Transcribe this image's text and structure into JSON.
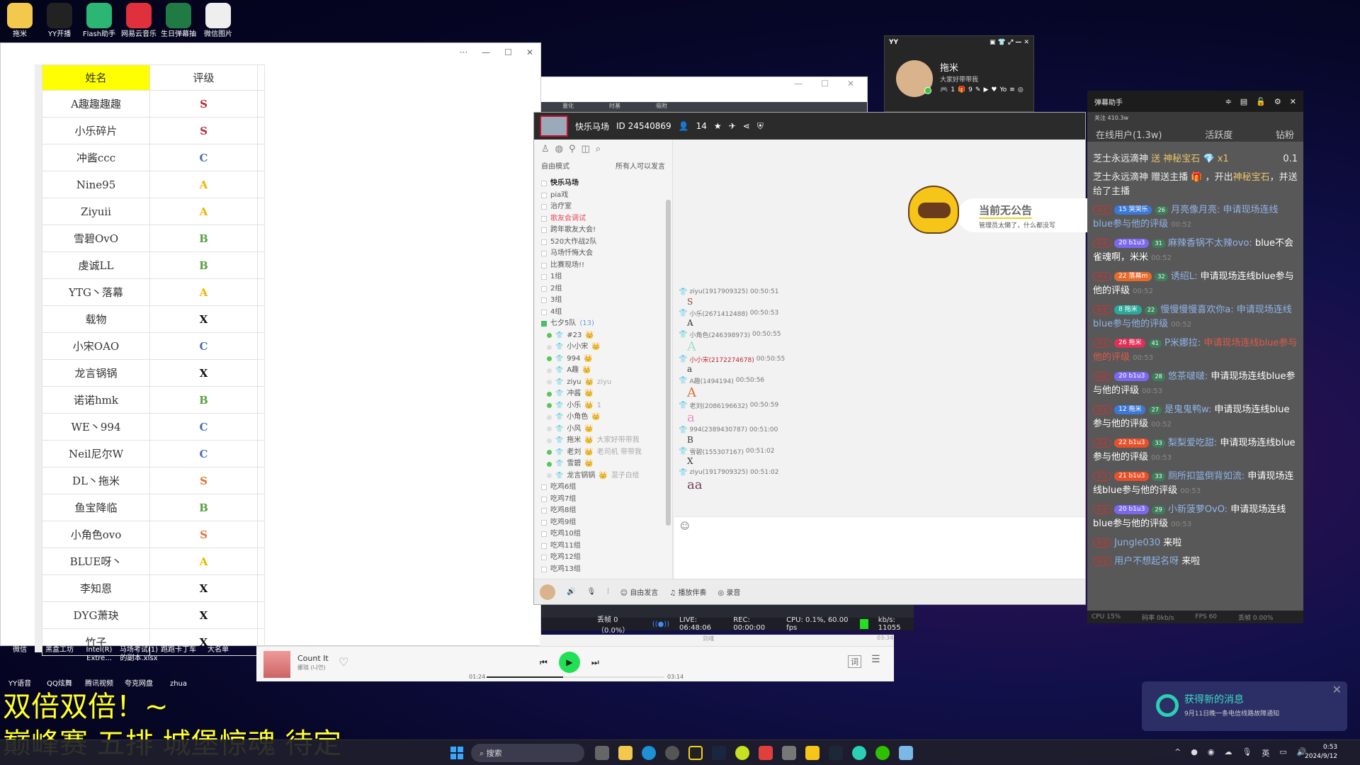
{
  "desktop_icons_top": [
    {
      "label": "拖米",
      "icon": "folder-icon",
      "color": "#f2c94c"
    },
    {
      "label": "YY开播",
      "icon": "yy-live-icon",
      "color": "#222"
    },
    {
      "label": "Flash助手",
      "icon": "flash-icon",
      "color": "#2bb673"
    },
    {
      "label": "网易云音乐",
      "icon": "netease-music-icon",
      "color": "#e0303c"
    },
    {
      "label": "生日弹幕抽",
      "icon": "excel-icon",
      "color": "#1f7a44"
    },
    {
      "label": "微信图片",
      "icon": "image-file-icon",
      "color": "#eee"
    }
  ],
  "desktop_icons_bottom_row1": [
    {
      "label": "微信"
    },
    {
      "label": "黑盒工坊"
    },
    {
      "label": "Intel(R) Extre..."
    },
    {
      "label": "马场考试(1)的副本.xlsx"
    },
    {
      "label": "跑跑卡丁车"
    },
    {
      "label": "大名单"
    }
  ],
  "desktop_icons_bottom_row2": [
    {
      "label": "YY语音"
    },
    {
      "label": "QQ炫舞"
    },
    {
      "label": "腾讯视频"
    },
    {
      "label": "夸克网盘"
    },
    {
      "label": "zhua"
    }
  ],
  "spreadsheet": {
    "window_controls": {
      "more": "···",
      "minimize": "—",
      "maximize": "☐",
      "close": "✕"
    },
    "headers": {
      "name": "姓名",
      "grade": "评级"
    },
    "rows": [
      {
        "name": "A趣趣趣趣",
        "grade": "S",
        "color": "#c0282e"
      },
      {
        "name": "小乐碎片",
        "grade": "S",
        "color": "#c0282e"
      },
      {
        "name": "冲酱ccc",
        "grade": "C",
        "color": "#4a6fb5"
      },
      {
        "name": "Nine95",
        "grade": "A",
        "color": "#f0b400"
      },
      {
        "name": "Ziyuii",
        "grade": "A",
        "color": "#f0b400"
      },
      {
        "name": "雪碧OvO",
        "grade": "B",
        "color": "#5aa040"
      },
      {
        "name": "虔诚LL",
        "grade": "B",
        "color": "#5aa040"
      },
      {
        "name": "YTG丶落幕",
        "grade": "A",
        "color": "#f0b400"
      },
      {
        "name": "载物",
        "grade": "X",
        "color": "#111111"
      },
      {
        "name": "小宋OAO",
        "grade": "C",
        "color": "#4a6fb5"
      },
      {
        "name": "龙言锅锅",
        "grade": "X",
        "color": "#111111"
      },
      {
        "name": "诺诺hmk",
        "grade": "B",
        "color": "#5aa040"
      },
      {
        "name": "WE丶994",
        "grade": "C",
        "color": "#4a6fb5"
      },
      {
        "name": "Neil尼尔W",
        "grade": "C",
        "color": "#4a6fb5"
      },
      {
        "name": "DL丶拖米",
        "grade": "S",
        "color": "#e07030"
      },
      {
        "name": "鱼宝降临",
        "grade": "B",
        "color": "#5aa040"
      },
      {
        "name": "小角色ovo",
        "grade": "S",
        "color": "#e07030"
      },
      {
        "name": "BLUE呀丶",
        "grade": "A",
        "color": "#f0b400"
      },
      {
        "name": "李知恩",
        "grade": "X",
        "color": "#111111"
      },
      {
        "name": "DYG萧玦",
        "grade": "X",
        "color": "#111111"
      },
      {
        "name": "竹子",
        "grade": "X",
        "color": "#111111"
      }
    ]
  },
  "behind_window": {
    "controls": {
      "minimize": "—",
      "maximize": "☐",
      "close": "✕"
    },
    "strip_labels": [
      "量化",
      "时基",
      "吸附"
    ]
  },
  "yy_room": {
    "room_name": "快乐马场",
    "room_id": "ID 24540869",
    "member_count": "14",
    "mode": "自由模式",
    "mode_desc": "所有人可以发言",
    "channels_top": [
      {
        "label": "快乐马场",
        "bold": true
      },
      {
        "label": "pia戏"
      },
      {
        "label": "治疗室"
      },
      {
        "label": "歌友会调试",
        "red": true
      },
      {
        "label": "跨年歌友大会!"
      },
      {
        "label": "520大作战2队"
      },
      {
        "label": "马场忏悔大会"
      },
      {
        "label": "比赛现场!!"
      },
      {
        "label": "1组"
      },
      {
        "label": "2组"
      },
      {
        "label": "3组"
      },
      {
        "label": "4组"
      }
    ],
    "expanded_channel": {
      "label": "七夕5队",
      "count": "(13)"
    },
    "users": [
      {
        "name": "#23",
        "online": true,
        "sig": ""
      },
      {
        "name": "小小宋",
        "online": false,
        "sig": ""
      },
      {
        "name": "994",
        "online": true,
        "sig": ""
      },
      {
        "name": "A趣",
        "online": false,
        "sig": ""
      },
      {
        "name": "ziyu",
        "online": false,
        "sig": "ziyu"
      },
      {
        "name": "冲酱",
        "online": true,
        "sig": ""
      },
      {
        "name": "小乐",
        "online": true,
        "sig": "1"
      },
      {
        "name": "小角色",
        "online": false,
        "sig": ""
      },
      {
        "name": "小风",
        "online": false,
        "sig": ""
      },
      {
        "name": "拖米",
        "online": false,
        "sig": "大家好带带我"
      },
      {
        "name": "老刘",
        "online": true,
        "sig": "老司机 带带我"
      },
      {
        "name": "雪碧",
        "online": true,
        "sig": ""
      },
      {
        "name": "龙言锅锅",
        "online": false,
        "sig": "混子白给"
      }
    ],
    "channels_bottom": [
      "吃鸡6组",
      "吃鸡7组",
      "吃鸡8组",
      "吃鸡9组",
      "吃鸡10组",
      "吃鸡11组",
      "吃鸡12组",
      "吃鸡13组"
    ],
    "notice": {
      "title": "当前无公告",
      "subtitle": "管理员太懒了，什么都没写"
    },
    "messages": [
      {
        "user": "ziyu(1917909325)",
        "time": "00:50:51",
        "text": "S",
        "color": "#8a3c3c"
      },
      {
        "user": "小乐(2671412488)",
        "time": "00:50:53",
        "text": "A",
        "color": "#333"
      },
      {
        "user": "小角色(246398973)",
        "time": "00:50:55",
        "text": "A",
        "color": "#9fe0d0"
      },
      {
        "user": "小小宋(2172274678)",
        "time": "00:50:55",
        "text": "a",
        "color": "#333",
        "usercolor": "#c0282e"
      },
      {
        "user": "A趣(1494194)",
        "time": "00:50:56",
        "text": "A",
        "color": "#e07030"
      },
      {
        "user": "老刘(2086196632)",
        "time": "00:50:59",
        "text": "a",
        "color": "#e890c0"
      },
      {
        "user": "994(2389430787)",
        "time": "00:51:00",
        "text": "B",
        "color": "#333"
      },
      {
        "user": "雪碧(155307167)",
        "time": "00:51:02",
        "text": "X",
        "color": "#333"
      },
      {
        "user": "ziyu(1917909325)",
        "time": "00:51:02",
        "text": "aa",
        "color": "#7a3c5a"
      }
    ],
    "bottom_bar": {
      "free_speak": "自由发言",
      "accompany": "播放伴奏",
      "record": "录音"
    }
  },
  "obs_status": {
    "dropped": "丢帧 0（0.0%）",
    "live": "LIVE: 06:48:06",
    "rec": "REC: 00:00:00",
    "cpu": "CPU: 0.1%, 60.00 fps",
    "kbs": "kb/s: 11055"
  },
  "yy_card": {
    "app": "YY",
    "name": "拖米",
    "signature": "大家好带带我",
    "badge1": "1",
    "badge2": "9"
  },
  "danmaku": {
    "title": "弹幕助手",
    "followers": "关注 410.3w",
    "tabs": [
      "在线用户(1.3w)",
      "活跃度",
      "钻粉"
    ],
    "gift_lines": [
      {
        "user": "芝士永远滴神",
        "action": "送 神秘宝石",
        "qty": "x1",
        "value": "0.1"
      },
      {
        "user": "芝士永远滴神",
        "text": "赠送主播",
        "tail": "，开出",
        "gift": "神秘宝石",
        "end": "，并送给了主播"
      }
    ],
    "follow_label": "关注",
    "comments": [
      {
        "fans_lv": "15",
        "fans": "哭哭乐",
        "fans_color": "#3b78d8",
        "lv": "26",
        "user": "月亮像月亮",
        "text": "申请现场连线blue参与他的评级",
        "text_class": "bl",
        "time": "00:52"
      },
      {
        "fans_lv": "20",
        "fans": "b1u3",
        "fans_color": "#7b68ee",
        "lv": "31",
        "user": "麻辣香锅不太辣ovo",
        "text": "blue不会雀魂啊，米米",
        "text_class": "wh",
        "time": "00:52"
      },
      {
        "fans_lv": "22",
        "fans": "落幕m",
        "fans_color": "#e86a2a",
        "lv": "32",
        "user": "诱绍L",
        "text": "申请现场连线blue参与他的评级",
        "text_class": "wh",
        "time": "00:52"
      },
      {
        "fans_lv": "8",
        "fans": "拖米",
        "fans_color": "#2aa89a",
        "lv": "22",
        "user": "慢慢慢慢喜欢你a",
        "text": "申请现场连线blue参与他的评级",
        "text_class": "bl",
        "time": "00:52"
      },
      {
        "fans_lv": "26",
        "fans": "拖米",
        "fans_color": "#e0305a",
        "lv": "41",
        "user": "P米娜拉",
        "text": "申请现场连线blue参与他的评级",
        "text_class": "rd",
        "time": "00:53"
      },
      {
        "fans_lv": "20",
        "fans": "b1u3",
        "fans_color": "#7b68ee",
        "lv": "28",
        "user": "悠茶啵啵",
        "text": "申请现场连线blue参与他的评级",
        "text_class": "wh",
        "time": "00:53"
      },
      {
        "fans_lv": "12",
        "fans": "拖米",
        "fans_color": "#3b78d8",
        "lv": "27",
        "user": "是鬼鬼鸭w",
        "text": "申请现场连线blue参与他的评级",
        "text_class": "wh",
        "time": "00:52"
      },
      {
        "fans_lv": "22",
        "fans": "b1u3",
        "fans_color": "#e8502a",
        "lv": "33",
        "user": "梨梨爱吃甜",
        "text": "申请现场连线blue参与他的评级",
        "text_class": "wh",
        "time": "00:53"
      },
      {
        "fans_lv": "21",
        "fans": "b1u3",
        "fans_color": "#e8502a",
        "lv": "33",
        "user": "厕所扣篮倒背如流",
        "text": "申请现场连线blue参与他的评级",
        "text_class": "wh",
        "time": "00:53"
      },
      {
        "fans_lv": "20",
        "fans": "b1u3",
        "fans_color": "#7b68ee",
        "lv": "29",
        "user": "小新菠萝OvO",
        "text": "申请现场连线blue参与他的评级",
        "text_class": "wh",
        "time": "00:53"
      }
    ],
    "enter_lines": [
      {
        "user": "Jungle030",
        "text": "来啦"
      },
      {
        "user": "用户不想起名呀",
        "text": "来啦"
      }
    ],
    "stats": {
      "cpu": "CPU 15%",
      "bitrate": "码率 0kb/s",
      "fps": "FPS 60",
      "drop": "丢帧 0.00%"
    }
  },
  "music": {
    "song": "Count It",
    "artist": "娜琏 (나연)",
    "elapsed": "01:24",
    "total": "03:14",
    "progress": 0.43,
    "lyric_btn": "词",
    "header_left": "剑魂",
    "header_right": "03:34"
  },
  "overlay": {
    "line1": "双倍双倍！~",
    "line2": "巅峰赛 五排 城堡惊魂 待定"
  },
  "notification": {
    "title": "获得新的消息",
    "body": "9月11日晚一条电信线路故障通知"
  },
  "taskbar": {
    "search": "搜索",
    "ime": "英",
    "time": "0:53",
    "date": "2024/9/12"
  }
}
